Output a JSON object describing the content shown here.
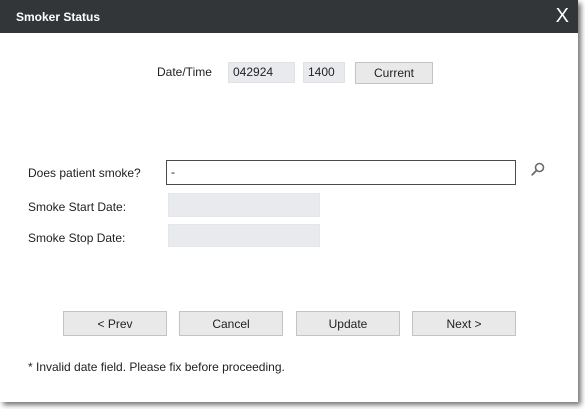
{
  "window": {
    "title": "Smoker Status",
    "close_label": "X"
  },
  "datetime": {
    "label": "Date/Time",
    "date_value": "042924",
    "time_value": "1400",
    "current_button": "Current"
  },
  "form": {
    "smoke_question_label": "Does patient smoke?",
    "smoke_value": "-",
    "start_date_label": "Smoke Start Date:",
    "stop_date_label": "Smoke Stop Date:"
  },
  "buttons": {
    "prev": "< Prev",
    "cancel": "Cancel",
    "update": "Update",
    "next": "Next >"
  },
  "footnote": "* Invalid date field. Please fix before proceeding.",
  "icons": {
    "lookup": "search-icon"
  }
}
